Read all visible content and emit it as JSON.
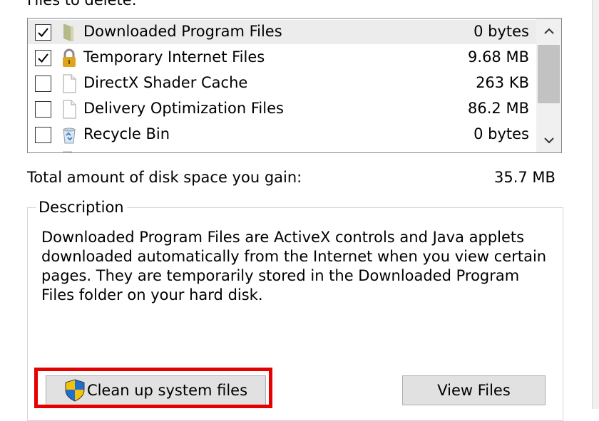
{
  "dialog": {
    "files_to_delete_label": "Files to delete:"
  },
  "file_list": {
    "items": [
      {
        "name": "Downloaded Program Files",
        "size": "0 bytes",
        "checked": true,
        "icon": "folder-icon",
        "selected": true
      },
      {
        "name": "Temporary Internet Files",
        "size": "9.68 MB",
        "checked": true,
        "icon": "lock-icon",
        "selected": false
      },
      {
        "name": "DirectX Shader Cache",
        "size": "263 KB",
        "checked": false,
        "icon": "document-icon",
        "selected": false
      },
      {
        "name": "Delivery Optimization Files",
        "size": "86.2 MB",
        "checked": false,
        "icon": "document-icon",
        "selected": false
      },
      {
        "name": "Recycle Bin",
        "size": "0 bytes",
        "checked": false,
        "icon": "recycle-bin-icon",
        "selected": false
      }
    ]
  },
  "total": {
    "label": "Total amount of disk space you gain:",
    "value": "35.7 MB"
  },
  "description": {
    "title": "Description",
    "text": "Downloaded Program Files are ActiveX controls and Java applets downloaded automatically from the Internet when you view certain pages. They are temporarily stored in the Downloaded Program Files folder on your hard disk."
  },
  "buttons": {
    "clean_up": "Clean up system files",
    "view_files": "View Files"
  },
  "colors": {
    "highlight": "#e60000",
    "selection": "#ececec",
    "button_face": "#e1e1e1"
  }
}
